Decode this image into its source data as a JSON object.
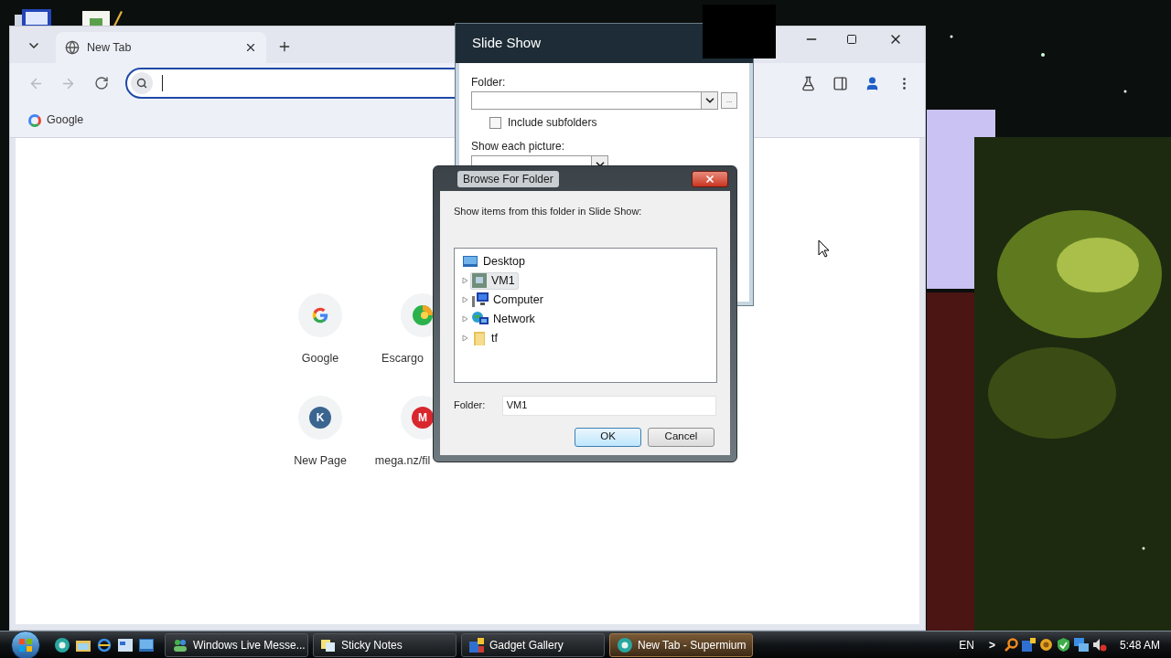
{
  "browser": {
    "tabs": [
      {
        "label": "New Tab",
        "selected": true
      }
    ],
    "bookmarks": [
      {
        "label": "Google"
      }
    ],
    "shortcuts": [
      {
        "label": "Google",
        "kind": "google"
      },
      {
        "label": "Escargo",
        "kind": "escargot"
      },
      {
        "label": "New Page",
        "kind": "letter",
        "letter": "K",
        "color": "#3b6591"
      },
      {
        "label": "mega.nz/fil",
        "kind": "letter",
        "letter": "M",
        "color": "#d9272e"
      }
    ]
  },
  "slideshow": {
    "title": "Slide Show",
    "folder_label": "Folder:",
    "browse_button": "...",
    "include_subfolders": {
      "label": "Include subfolders",
      "checked": false
    },
    "show_each_label": "Show each picture:"
  },
  "browse_dialog": {
    "title": "Browse For Folder",
    "prompt": "Show items from this folder in Slide Show:",
    "tree": [
      {
        "label": "Desktop",
        "kind": "desktop",
        "children": [
          {
            "label": "VM1",
            "kind": "vm",
            "selected": true,
            "expanded": false
          },
          {
            "label": "Computer",
            "kind": "computer",
            "selected": false,
            "expanded": false
          },
          {
            "label": "Network",
            "kind": "network",
            "selected": false,
            "expanded": false
          },
          {
            "label": "tf",
            "kind": "folder",
            "selected": false,
            "expanded": false
          }
        ]
      }
    ],
    "folder_label": "Folder:",
    "folder_value": "VM1",
    "buttons": [
      {
        "label": "OK",
        "kind": "default"
      },
      {
        "label": "Cancel",
        "kind": "normal"
      }
    ]
  },
  "taskbar": {
    "tasks": [
      {
        "label": "Windows Live Messe...",
        "kind": "messenger",
        "selected": false
      },
      {
        "label": "Sticky Notes",
        "kind": "notes",
        "selected": false
      },
      {
        "label": "Gadget Gallery",
        "kind": "gadget",
        "selected": false
      },
      {
        "label": "New Tab - Supermium",
        "kind": "browser",
        "selected": true
      }
    ],
    "language": "EN",
    "tray_toggle": ">",
    "clock": "5:48 AM"
  }
}
